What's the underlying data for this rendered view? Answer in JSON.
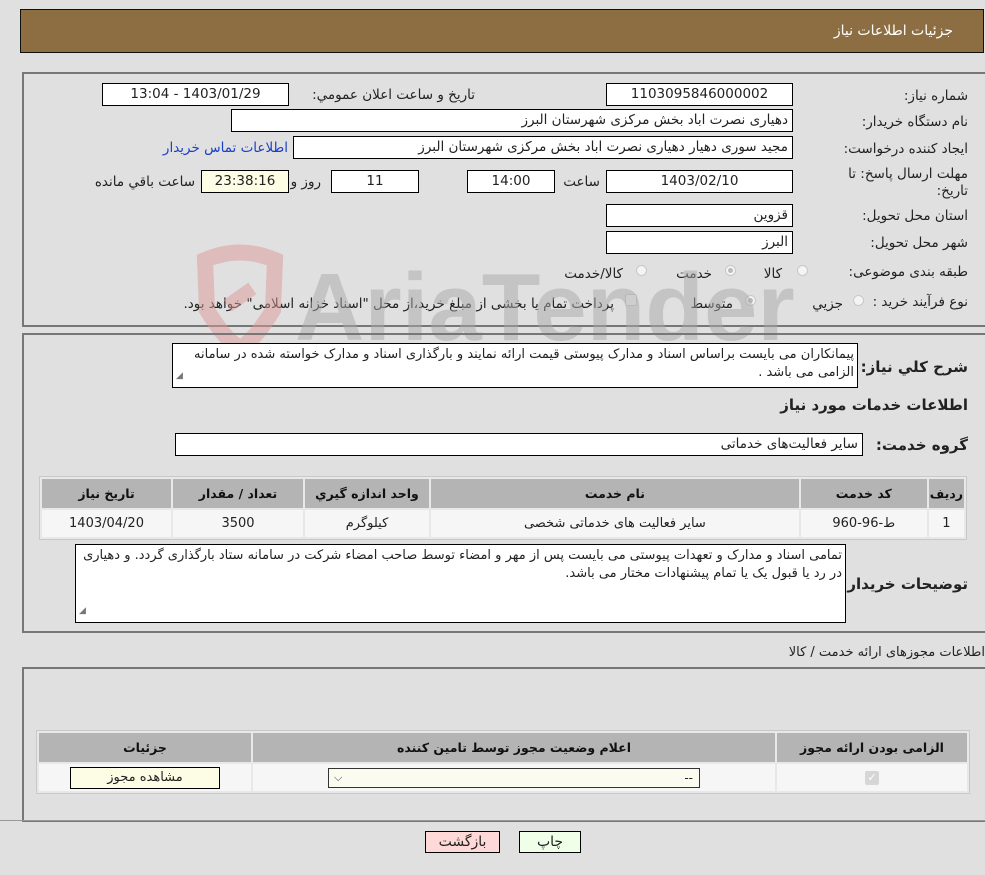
{
  "header": {
    "title": "جزئیات اطلاعات نیاز"
  },
  "form": {
    "need_number_label": "شماره نیاز:",
    "need_number": "1103095846000002",
    "announce_label": "تاریخ و ساعت اعلان عمومي:",
    "announce_value": "1403/01/29 - 13:04",
    "buyer_org_label": "نام دستگاه خريدار:",
    "buyer_org": "دهیاری نصرت اباد بخش مرکزی شهرستان البرز",
    "creator_label": "ایجاد کننده درخواست:",
    "creator": "مجید سوری دهیار دهیاری نصرت اباد بخش مرکزی شهرستان البرز",
    "contact_link": "اطلاعات تماس خریدار",
    "deadline_label": "مهلت ارسال پاسخ: تا تاریخ:",
    "deadline_date": "1403/02/10",
    "time_label": "ساعت",
    "deadline_time": "14:00",
    "days_value": "11",
    "days_label": "روز و",
    "remaining_time": "23:38:16",
    "remaining_label": "ساعت باقي مانده",
    "province_label": "استان محل تحویل:",
    "province": "قزوین",
    "city_label": "شهر محل تحویل:",
    "city": "البرز",
    "category_label": "طبقه بندی موضوعی:",
    "category_options": [
      {
        "label": "کالا",
        "selected": false
      },
      {
        "label": "خدمت",
        "selected": true
      },
      {
        "label": "کالا/خدمت",
        "selected": false
      }
    ],
    "process_label": "نوع فرآیند خرید :",
    "process_options": [
      {
        "label": "جزيي",
        "selected": false
      },
      {
        "label": "متوسط",
        "selected": true
      }
    ],
    "treasury_note": "پرداخت تمام یا بخشی از مبلغ خرید،از محل \"اسناد خزانه اسلامی\" خواهد بود.",
    "treasury_checked": false
  },
  "description": {
    "label": "شرح كلي نياز:",
    "text": "پیمانکاران می بایست براساس اسناد و مدارک پیوستی قیمت ارائه نمایند و بارگذاری اسناد و مدارک خواسته شده در سامانه الزامی می باشد ."
  },
  "services": {
    "section_title": "اطلاعات خدمات مورد نياز",
    "group_label": "گروه خدمت:",
    "group_value": "سایر فعالیت‌های خدماتی",
    "columns": [
      "رديف",
      "كد خدمت",
      "نام خدمت",
      "واحد اندازه گيري",
      "تعداد / مقدار",
      "تاريخ نياز"
    ],
    "rows": [
      {
        "index": "1",
        "code": "ط-96-960",
        "name": "سایر فعالیت های خدماتی شخصی",
        "unit": "کیلوگرم",
        "qty": "3500",
        "date": "1403/04/20"
      }
    ]
  },
  "buyer_notes": {
    "label": "توضیحات خریدار:",
    "text": "تمامی اسناد و مدارک و تعهدات پیوستی می بایست پس از مهر و امضاء توسط صاحب امضاء شرکت در سامانه ستاد بارگذاری گردد. و دهیاری در رد یا قبول یک یا تمام پیشنهادات مختار می باشد."
  },
  "licenses": {
    "section_title": "اطلاعات مجوزهای ارائه خدمت / کالا",
    "columns": [
      "الزامی بودن ارائه مجوز",
      "اعلام وضعیت مجوز توسط تامین کننده",
      "جزئیات"
    ],
    "rows": [
      {
        "required": true,
        "status_value": "--",
        "details_button": "مشاهده مجوز"
      }
    ]
  },
  "footer": {
    "print_label": "چاپ",
    "back_label": "بازگشت"
  },
  "watermark": {
    "text": "AriaTender.neT"
  }
}
